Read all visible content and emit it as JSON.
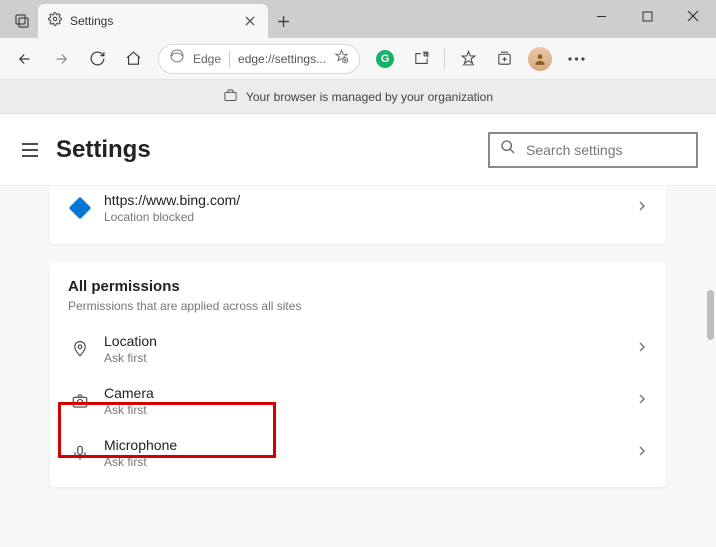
{
  "tab": {
    "title": "Settings"
  },
  "address": {
    "label": "Edge",
    "url": "edge://settings..."
  },
  "infobar": {
    "message": "Your browser is managed by your organization"
  },
  "header": {
    "title": "Settings"
  },
  "search": {
    "placeholder": "Search settings"
  },
  "recent": {
    "site": "https://www.bing.com/",
    "status": "Location blocked"
  },
  "allPerms": {
    "title": "All permissions",
    "subtitle": "Permissions that are applied across all sites"
  },
  "perms": {
    "location": {
      "title": "Location",
      "sub": "Ask first"
    },
    "camera": {
      "title": "Camera",
      "sub": "Ask first"
    },
    "microphone": {
      "title": "Microphone",
      "sub": "Ask first"
    }
  }
}
